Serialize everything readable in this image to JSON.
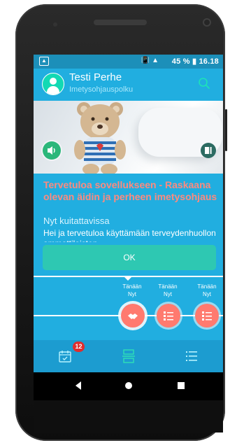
{
  "status_bar": {
    "battery_percent": "45 %",
    "time": "16.18",
    "icons": [
      "photo-icon",
      "vibrate-icon",
      "signal-icon",
      "battery-icon"
    ]
  },
  "header": {
    "user_name": "Testi Perhe",
    "subtitle": "Imetysohjauspolku"
  },
  "content": {
    "title": "Tervetuloa sovellukseen - Raskaana olevan äidin ja perheen imetysohjaus",
    "status": "Nyt kuitattavissa",
    "greeting": "Hei ja tervetuloa käyttämään terveydenhuollon ammattilaisten"
  },
  "ok_button": {
    "label": "OK"
  },
  "timeline": {
    "items": [
      {
        "day": "Tänään",
        "time": "Nyt",
        "icon": "handshake-icon",
        "active": true
      },
      {
        "day": "Tänään",
        "time": "Nyt",
        "icon": "checklist-icon",
        "active": false
      },
      {
        "day": "Tänään",
        "time": "Nyt",
        "icon": "checklist-icon",
        "active": false
      }
    ]
  },
  "tabs": {
    "calendar_badge": "12",
    "items": [
      "calendar-icon",
      "timeline-icon",
      "list-icon"
    ]
  },
  "colors": {
    "primary": "#21aee0",
    "accent_coral": "#ff7a6f",
    "ok_button": "#2ec8b2",
    "badge": "#e02d2d"
  }
}
